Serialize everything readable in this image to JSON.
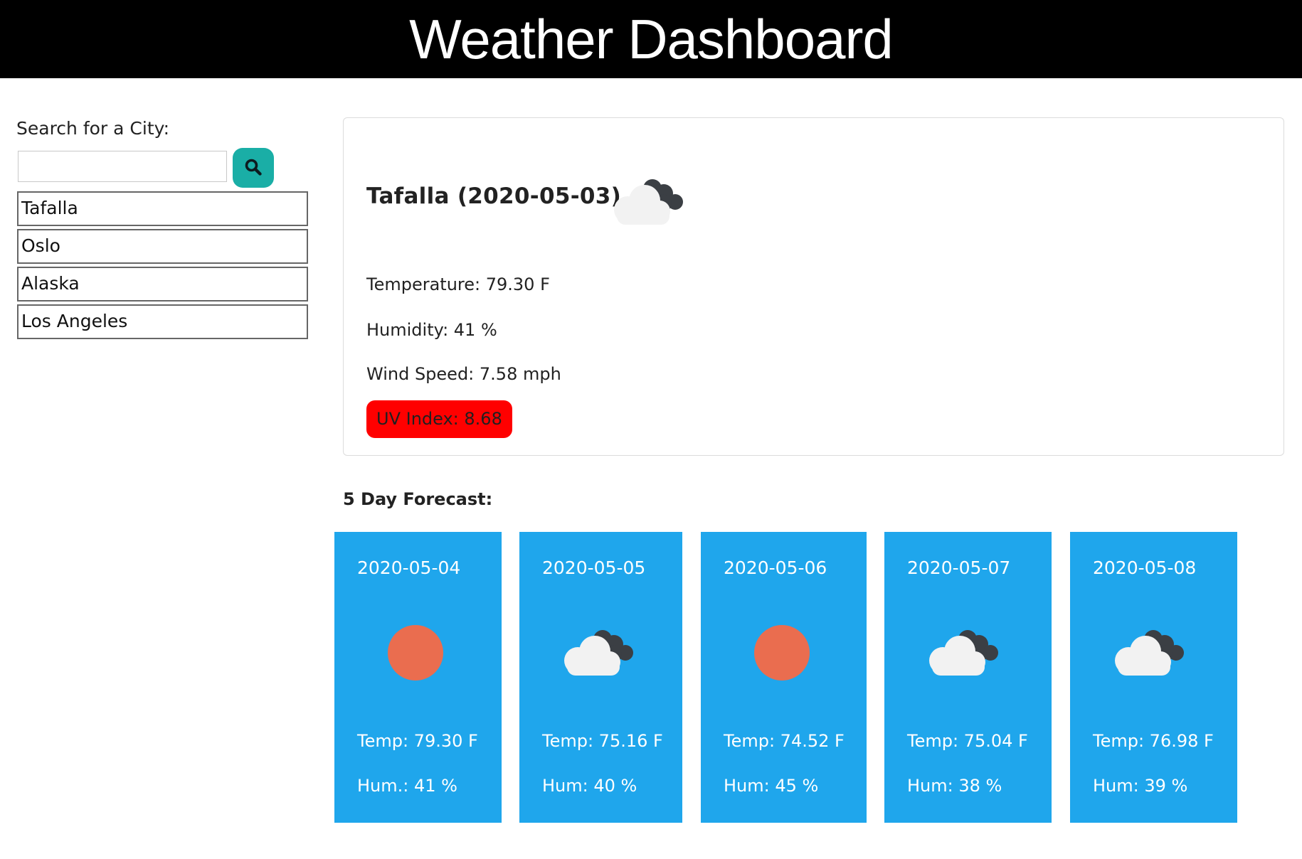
{
  "header": {
    "title": "Weather Dashboard"
  },
  "search": {
    "label": "Search for a City:",
    "value": "",
    "button_icon": "search-icon"
  },
  "cities": [
    "Tafalla",
    "Oslo",
    "Alaska",
    "Los Angeles"
  ],
  "current": {
    "title": "Tafalla (2020-05-03)",
    "icon": "cloudy-icon",
    "temperature": "Temperature: 79.30 F",
    "humidity": "Humidity: 41 %",
    "wind": "Wind Speed: 7.58 mph",
    "uv": "UV Index: 8.68",
    "uv_color": "#ff0000"
  },
  "forecast": {
    "title": "5 Day Forecast:",
    "card_color": "#1fa6ec",
    "days": [
      {
        "date": "2020-05-04",
        "icon": "sun-icon",
        "temp": "Temp: 79.30 F",
        "hum": "Hum.: 41 %"
      },
      {
        "date": "2020-05-05",
        "icon": "cloudy-icon",
        "temp": "Temp: 75.16 F",
        "hum": "Hum: 40 %"
      },
      {
        "date": "2020-05-06",
        "icon": "sun-icon",
        "temp": "Temp: 74.52 F",
        "hum": "Hum: 45 %"
      },
      {
        "date": "2020-05-07",
        "icon": "cloudy-icon",
        "temp": "Temp: 75.04 F",
        "hum": "Hum: 38 %"
      },
      {
        "date": "2020-05-08",
        "icon": "cloudy-icon",
        "temp": "Temp: 76.98 F",
        "hum": "Hum: 39 %"
      }
    ]
  }
}
